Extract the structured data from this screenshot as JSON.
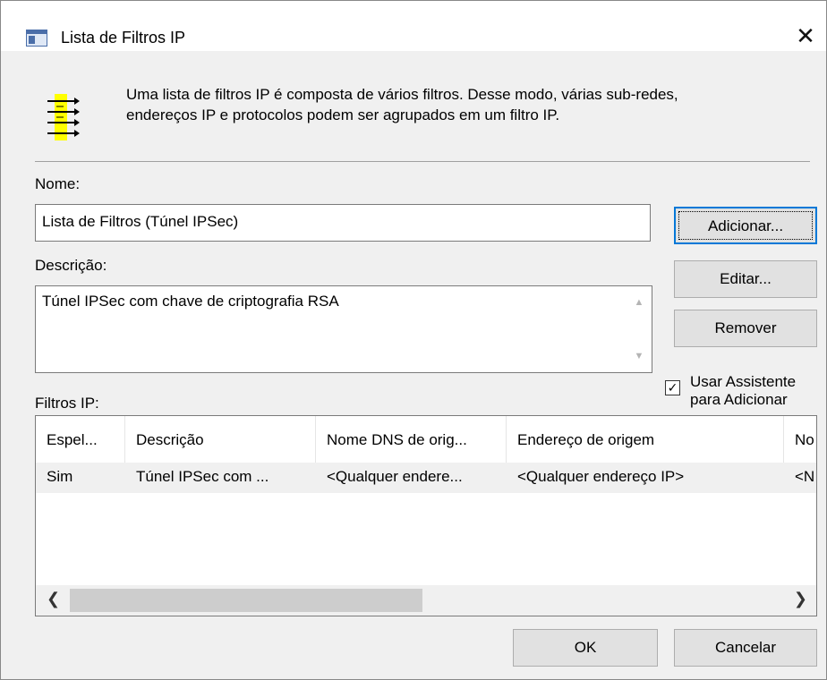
{
  "window": {
    "title": "Lista de Filtros IP",
    "close_glyph": "✕"
  },
  "intro_text_line1": "Uma lista de filtros IP é composta de vários filtros. Desse modo, várias sub-redes,",
  "intro_text_line2": "endereços IP e protocolos podem ser agrupados em um filtro IP.",
  "name_label": "Nome:",
  "name_value": "Lista de Filtros (Túnel IPSec)",
  "description_label": "Descrição:",
  "description_value": "Túnel IPSec com chave de criptografia RSA",
  "buttons": {
    "add": "Adicionar...",
    "edit": "Editar...",
    "remove": "Remover",
    "ok": "OK",
    "cancel": "Cancelar"
  },
  "wizard_checkbox": {
    "line1": "Usar Assistente",
    "line2": "para Adicionar",
    "checked": true
  },
  "filters_label": "Filtros IP:",
  "table": {
    "headers": [
      "Espel...",
      "Descrição",
      "Nome DNS de orig...",
      "Endereço de origem",
      "No"
    ],
    "rows": [
      [
        "Sim",
        "Túnel IPSec com ...",
        "<Qualquer endere...",
        "<Qualquer endereço IP>",
        "<N"
      ]
    ]
  },
  "colors": {
    "accent": "#0078d7",
    "icon_yellow": "#ffff00"
  },
  "icons": [
    "window-icon",
    "close-icon",
    "filter-list-icon",
    "scroll-up-icon",
    "scroll-down-icon",
    "scroll-left-icon",
    "scroll-right-icon",
    "checkmark-icon"
  ]
}
